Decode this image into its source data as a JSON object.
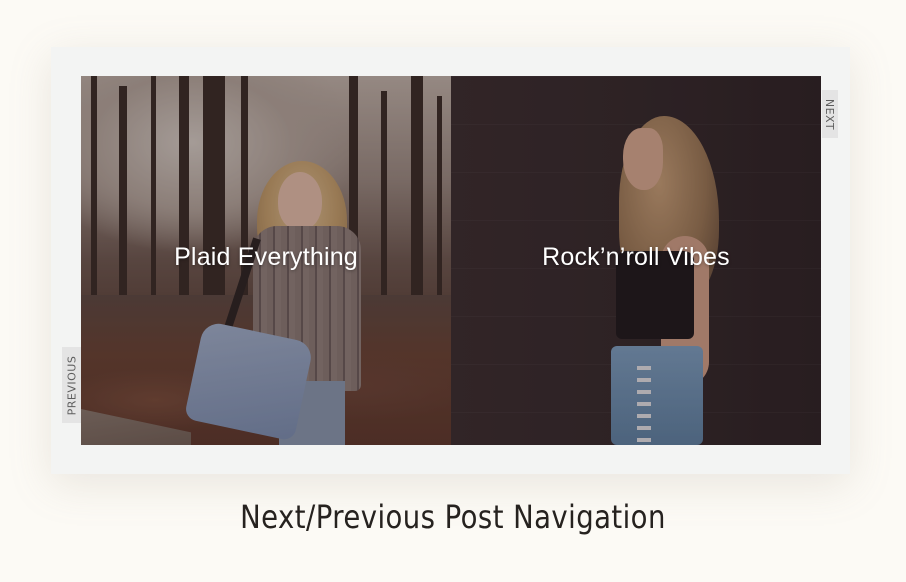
{
  "navigation": {
    "previous": {
      "tab_label": "PREVIOUS",
      "post_title": "Plaid Everything"
    },
    "next": {
      "tab_label": "NEXT",
      "post_title": "Rock’n’roll Vibes"
    }
  },
  "caption": "Next/Previous Post Navigation",
  "colors": {
    "page_background": "#fcfaf5",
    "card_background": "#f3f4f3",
    "tab_background": "#e4e4e4",
    "title_text": "#ffffff",
    "caption_text": "#26221f"
  }
}
